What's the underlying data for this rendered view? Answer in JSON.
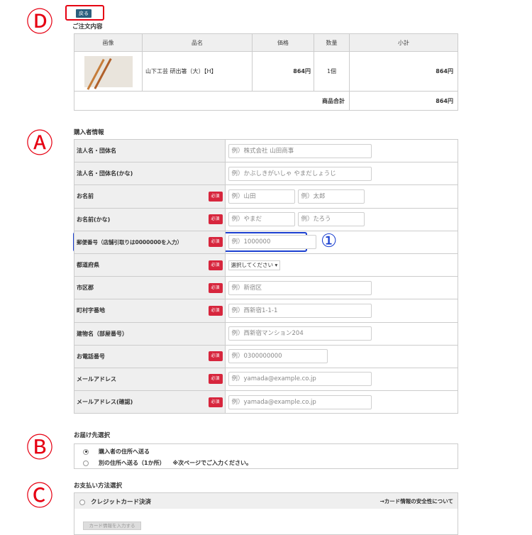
{
  "annotations": {
    "a": "Ⓐ",
    "b": "Ⓑ",
    "c": "Ⓒ",
    "d": "Ⓓ",
    "one": "①"
  },
  "back_label": "戻る",
  "order": {
    "title": "ご注文内容",
    "headers": [
      "画像",
      "品名",
      "価格",
      "数量",
      "小計"
    ],
    "item": {
      "name": "山下工芸 研出箸（大）【H】",
      "price": "864円",
      "qty": "1個",
      "subtotal": "864円"
    },
    "total_label": "商品合計",
    "total_value": "864円"
  },
  "buyer": {
    "title": "購入者情報",
    "required_badge": "必須",
    "rows": [
      {
        "label": "法人名・団体名",
        "placeholders": [
          "例）株式会社 山田商事"
        ]
      },
      {
        "label": "法人名・団体名(かな)",
        "placeholders": [
          "例）かぶしきがいしゃ やまだしょうじ"
        ]
      },
      {
        "label": "お名前",
        "placeholders": [
          "例）山田",
          "例）太郎"
        ]
      },
      {
        "label": "お名前(かな)",
        "placeholders": [
          "例）やまだ",
          "例）たろう"
        ]
      },
      {
        "label": "郵便番号（店舗引取りは0000000を入力）",
        "placeholders": [
          "例）1000000"
        ]
      },
      {
        "label": "都道府県",
        "select": "選択してください"
      },
      {
        "label": "市区郡",
        "placeholders": [
          "例）新宿区"
        ]
      },
      {
        "label": "町村字番地",
        "placeholders": [
          "例）西新宿1-1-1"
        ]
      },
      {
        "label": "建物名（部屋番号）",
        "placeholders": [
          "例）西新宿マンション204"
        ]
      },
      {
        "label": "お電話番号",
        "placeholders": [
          "例）0300000000"
        ]
      },
      {
        "label": "メールアドレス",
        "placeholders": [
          "例）yamada@example.co.jp"
        ]
      },
      {
        "label": "メールアドレス(確認)",
        "placeholders": [
          "例）yamada@example.co.jp"
        ]
      }
    ]
  },
  "delivery": {
    "title": "お届け先選択",
    "option1": "購入者の住所へ送る",
    "option2": "別の住所へ送る（1か所）",
    "option2_note": "※次ページでご入力ください。"
  },
  "payment": {
    "title": "お支払い方法選択",
    "method": "クレジットカード決済",
    "link": "→カード情報の安全性について",
    "card_button": "カード情報を入力する"
  },
  "colors": {
    "annotation_red": "#e60012",
    "annotation_blue": "#1a3fd0",
    "badge": "#d7263d",
    "back_button": "#2b5f7e"
  }
}
